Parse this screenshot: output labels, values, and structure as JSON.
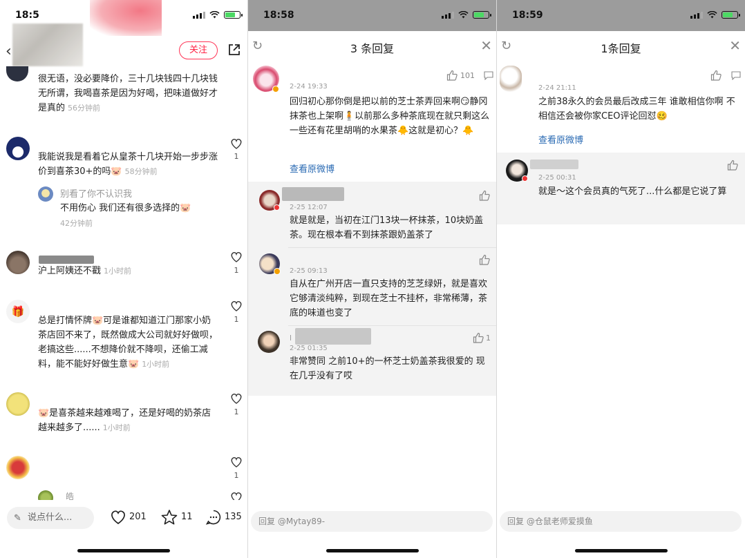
{
  "left": {
    "time": "18:5",
    "follow_label": "关注",
    "comments": [
      {
        "text": "很无语，没必要降价，三十几块钱四十几块钱无所谓，我喝喜茶是因为好喝，把味道做好才是真的",
        "time": "56分钟前"
      },
      {
        "text": "我能说我是看着它从皇茶十几块开始一步步涨价到喜茶30+的吗🐷",
        "time": "58分钟前",
        "likes": "1",
        "reply": {
          "name": "别看了你不认识我",
          "text": "不用伤心 我们还有很多选择的🐷",
          "time": "42分钟前"
        }
      },
      {
        "text": "沪上阿姨还不戳",
        "time": "1小时前",
        "likes": "1"
      },
      {
        "text": "总是打情怀牌🐷可是谁都知道江门那家小奶茶店回不来了，既然做成大公司就好好做呗，老搞这些......不想降价就不降呗，还偷工减料，能不能好好做生意🐷",
        "time": "1小时前",
        "likes": "1"
      },
      {
        "text": "🐷是喜茶越来越难喝了，还是好喝的奶茶店越来越多了......",
        "time": "1小时前",
        "likes": "1"
      },
      {
        "likes": "1"
      },
      {
        "name": "皓"
      }
    ],
    "bottom": {
      "say_placeholder": "说点什么...",
      "likes": "201",
      "stars": "11",
      "comments": "135"
    }
  },
  "middle": {
    "time": "18:58",
    "title": "3 条回复",
    "main": {
      "likes": "101",
      "time": "2-24 19:33",
      "text": "回归初心那你倒是把以前的芝士茶弄回来啊😏静冈抹茶也上架啊🧍以前那么多种茶底现在就只剩这么一些还有花里胡哨的水果茶🐥这就是初心？🐥",
      "link": "查看原微博"
    },
    "replies": [
      {
        "time": "2-25 12:07",
        "text": "就是就是，当初在江门13块一杯抹茶，10块奶盖茶。现在根本看不到抹茶跟奶盖茶了"
      },
      {
        "time": "2-25 09:13",
        "text": "自从在广州开店一直只支持的芝芝绿妍，就是喜欢它够清淡纯粹，到现在芝士不挂杯，非常稀薄，茶底的味道也变了"
      },
      {
        "time": "2-25 01:35",
        "text": "非常赞同 之前10+的一杯芝士奶盖茶我很爱的 现在几乎没有了哎",
        "likes": "1",
        "name_initial": "l"
      }
    ],
    "composer": "回复 @Mytay89-"
  },
  "right": {
    "time": "18:59",
    "title": "1条回复",
    "main": {
      "time": "2-24 21:11",
      "text": "之前38永久的会员最后改成三年 谁敢相信你啊 不相信还会被你家CEO评论回怼🥴",
      "link": "查看原微博"
    },
    "replies": [
      {
        "time": "2-25 00:31",
        "text": "就是～这个会员真的气死了...什么都是它说了算"
      }
    ],
    "composer": "回复 @仓鼠老师爱摸鱼"
  }
}
